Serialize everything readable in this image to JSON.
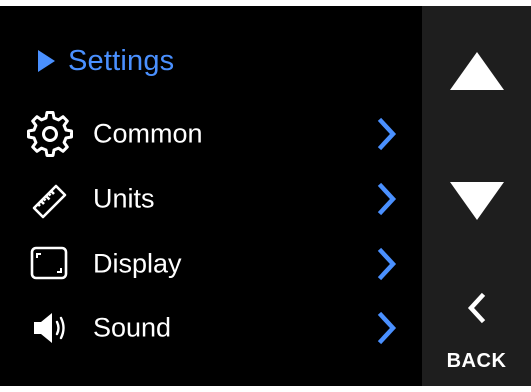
{
  "header": {
    "title": "Settings",
    "icon": "caret-right-icon",
    "color": "#4a90ff"
  },
  "menu": {
    "items": [
      {
        "label": "Common",
        "icon": "gear-icon"
      },
      {
        "label": "Units",
        "icon": "ruler-icon"
      },
      {
        "label": "Display",
        "icon": "display-icon"
      },
      {
        "label": "Sound",
        "icon": "speaker-icon"
      }
    ],
    "chevron_icon": "chevron-right-icon",
    "chevron_color": "#4a90ff"
  },
  "side": {
    "up_icon": "arrow-up-icon",
    "down_icon": "arrow-down-icon",
    "back_icon": "chevron-left-icon",
    "back_label": "BACK",
    "background": "#1e1e1e"
  }
}
